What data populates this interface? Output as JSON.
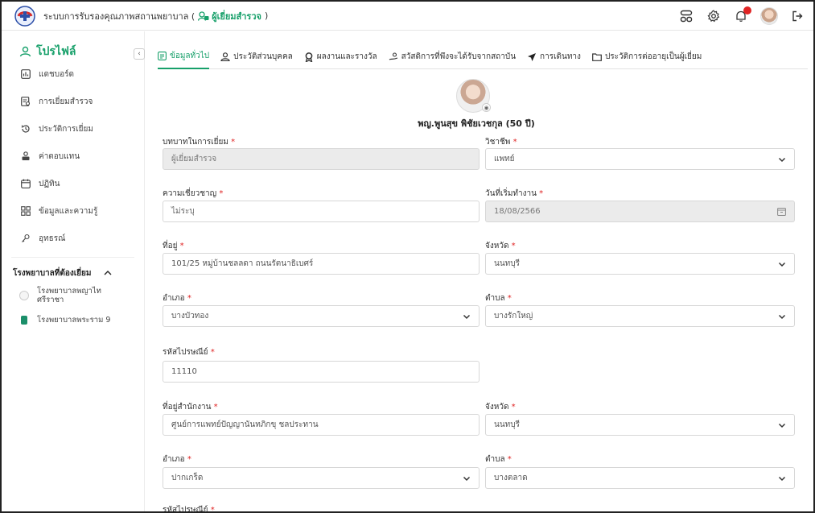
{
  "header": {
    "title_prefix": "ระบบการรับรองคุณภาพสถานพยาบาล (",
    "role": "ผู้เยี่ยมสำรวจ",
    "title_suffix": ")"
  },
  "sidebar": {
    "heading": "โปรไฟล์",
    "items": [
      {
        "label": "แดชบอร์ด",
        "icon": "dashboard-icon"
      },
      {
        "label": "การเยี่ยมสำรวจ",
        "icon": "survey-icon"
      },
      {
        "label": "ประวัติการเยี่ยม",
        "icon": "history-icon"
      },
      {
        "label": "ค่าตอบแทน",
        "icon": "payment-icon"
      },
      {
        "label": "ปฏิทิน",
        "icon": "calendar-icon"
      },
      {
        "label": "ข้อมูลและความรู้",
        "icon": "knowledge-icon"
      },
      {
        "label": "อุทธรณ์",
        "icon": "appeal-icon"
      }
    ],
    "section_title": "โรงพยาบาลที่ต้องเยี่ยม",
    "hospitals": [
      {
        "name": "โรงพยาบาลพญาไท ศรีราชา"
      },
      {
        "name": "โรงพยาบาลพระราม 9"
      }
    ]
  },
  "tabs": [
    {
      "label": "ข้อมูลทั่วไป",
      "icon": "info-icon",
      "active": true
    },
    {
      "label": "ประวัติส่วนบุคคล",
      "icon": "person-icon",
      "active": false
    },
    {
      "label": "ผลงานและรางวัล",
      "icon": "award-icon",
      "active": false
    },
    {
      "label": "สวัสดิการที่พึงจะได้รับจากสถาบัน",
      "icon": "welfare-icon",
      "active": false
    },
    {
      "label": "การเดินทาง",
      "icon": "plane-icon",
      "active": false
    },
    {
      "label": "ประวัติการต่ออายุเป็นผู้เยี่ยม",
      "icon": "folder-icon",
      "active": false
    }
  ],
  "profile": {
    "name": "พญ.พูนสุข พิชัยเวชกุล (50 ปี)"
  },
  "form": {
    "role_label": "บทบาทในการเยี่ยม",
    "role_value": "ผู้เยี่ยมสำรวจ",
    "profession_label": "วิชาชีพ",
    "profession_value": "แพทย์",
    "expertise_label": "ความเชี่ยวชาญ",
    "expertise_placeholder": "ไม่ระบุ",
    "start_date_label": "วันที่เริ่มทำงาน",
    "start_date_value": "18/08/2566",
    "address_label": "ที่อยู่",
    "address_value": "101/25 หมู่บ้านชลลดา ถนนรัตนาธิเบศร์",
    "province_label": "จังหวัด",
    "province_value": "นนทบุรี",
    "district_label": "อำเภอ",
    "district_value": "บางบัวทอง",
    "subdistrict_label": "ตำบล",
    "subdistrict_value": "บางรักใหญ่",
    "postcode_label": "รหัสไปรษณีย์",
    "postcode_value": "11110",
    "work_address_label": "ที่อยู่สำนักงาน",
    "work_address_value": "ศูนย์การแพทย์ปัญญานันทภิกขุ ชลประทาน",
    "work_province_label": "จังหวัด",
    "work_province_value": "นนทบุรี",
    "work_district_label": "อำเภอ",
    "work_district_value": "ปากเกร็ด",
    "work_subdistrict_label": "ตำบล",
    "work_subdistrict_value": "บางตลาด",
    "work_postcode_label": "รหัสไปรษณีย์"
  },
  "colors": {
    "accent": "#17a06a",
    "required": "#e02424"
  }
}
